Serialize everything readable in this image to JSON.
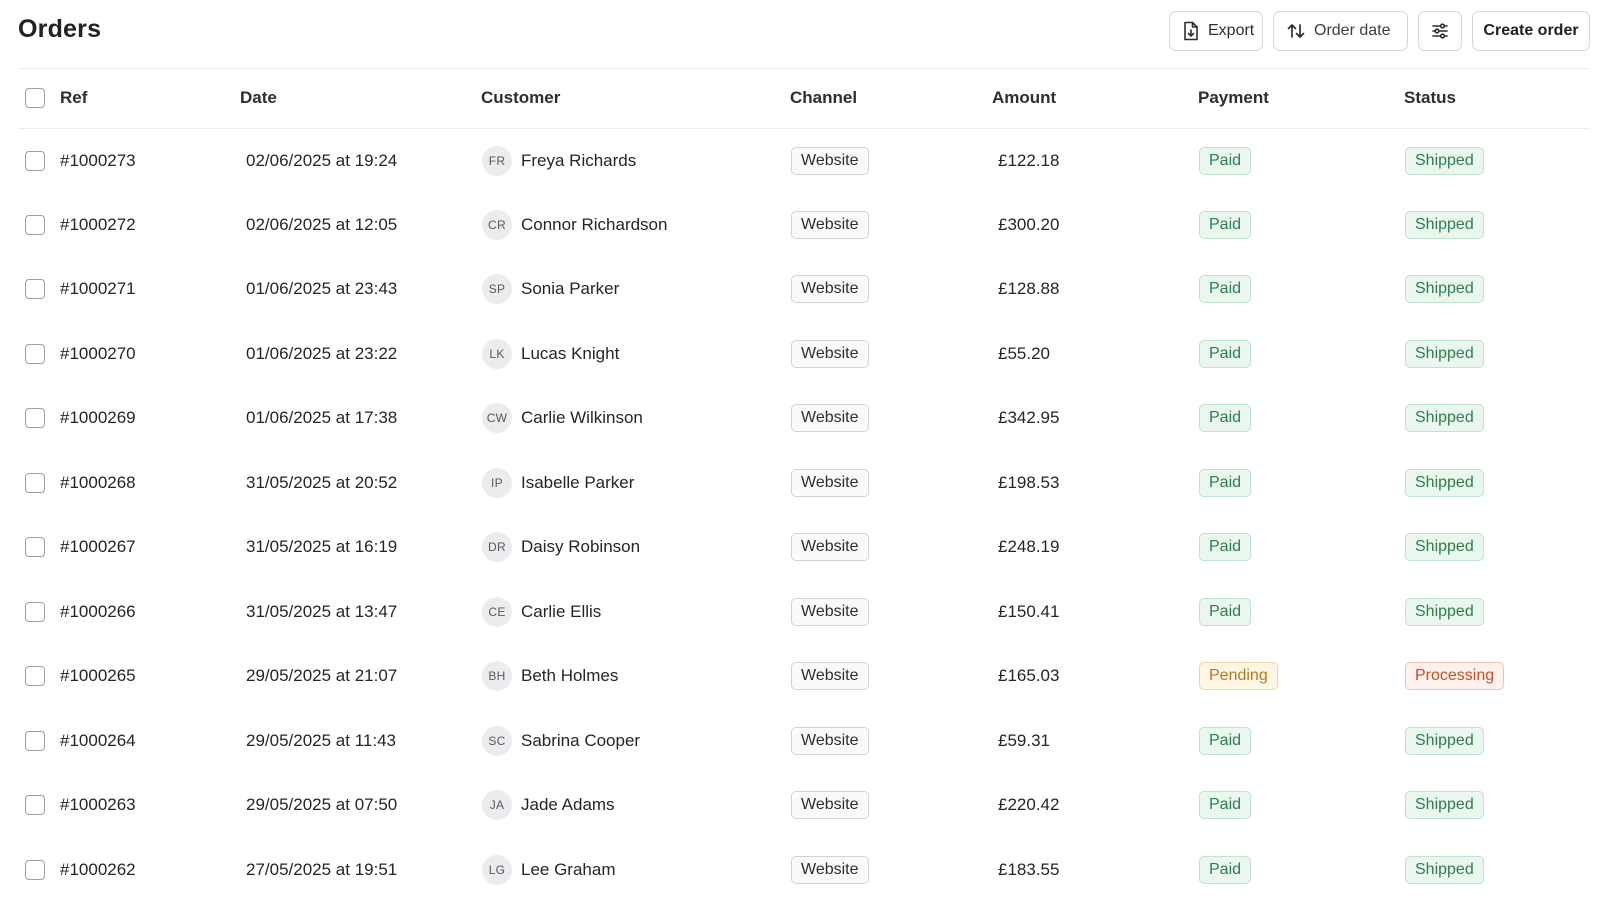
{
  "page": {
    "title": "Orders"
  },
  "toolbar": {
    "export_label": "Export",
    "sort_label": "Order date",
    "create_label": "Create order"
  },
  "columns": {
    "ref": "Ref",
    "date": "Date",
    "customer": "Customer",
    "channel": "Channel",
    "amount": "Amount",
    "payment": "Payment",
    "status": "Status"
  },
  "colors": {
    "paid_bg": "#e9f7ee",
    "paid_text": "#2f7d4e",
    "pending_bg": "#fff6e6",
    "pending_text": "#b7791f",
    "processing_bg": "#fff1ec",
    "processing_text": "#c2502a"
  },
  "orders": [
    {
      "ref": "#1000273",
      "date": "02/06/2025 at 19:24",
      "initials": "FR",
      "customer": "Freya Richards",
      "channel": "Website",
      "amount": "£122.18",
      "payment": "Paid",
      "status": "Shipped"
    },
    {
      "ref": "#1000272",
      "date": "02/06/2025 at 12:05",
      "initials": "CR",
      "customer": "Connor Richardson",
      "channel": "Website",
      "amount": "£300.20",
      "payment": "Paid",
      "status": "Shipped"
    },
    {
      "ref": "#1000271",
      "date": "01/06/2025 at 23:43",
      "initials": "SP",
      "customer": "Sonia Parker",
      "channel": "Website",
      "amount": "£128.88",
      "payment": "Paid",
      "status": "Shipped"
    },
    {
      "ref": "#1000270",
      "date": "01/06/2025 at 23:22",
      "initials": "LK",
      "customer": "Lucas Knight",
      "channel": "Website",
      "amount": "£55.20",
      "payment": "Paid",
      "status": "Shipped"
    },
    {
      "ref": "#1000269",
      "date": "01/06/2025 at 17:38",
      "initials": "CW",
      "customer": "Carlie Wilkinson",
      "channel": "Website",
      "amount": "£342.95",
      "payment": "Paid",
      "status": "Shipped"
    },
    {
      "ref": "#1000268",
      "date": "31/05/2025 at 20:52",
      "initials": "IP",
      "customer": "Isabelle Parker",
      "channel": "Website",
      "amount": "£198.53",
      "payment": "Paid",
      "status": "Shipped"
    },
    {
      "ref": "#1000267",
      "date": "31/05/2025 at 16:19",
      "initials": "DR",
      "customer": "Daisy Robinson",
      "channel": "Website",
      "amount": "£248.19",
      "payment": "Paid",
      "status": "Shipped"
    },
    {
      "ref": "#1000266",
      "date": "31/05/2025 at 13:47",
      "initials": "CE",
      "customer": "Carlie Ellis",
      "channel": "Website",
      "amount": "£150.41",
      "payment": "Paid",
      "status": "Shipped"
    },
    {
      "ref": "#1000265",
      "date": "29/05/2025 at 21:07",
      "initials": "BH",
      "customer": "Beth Holmes",
      "channel": "Website",
      "amount": "£165.03",
      "payment": "Pending",
      "status": "Processing"
    },
    {
      "ref": "#1000264",
      "date": "29/05/2025 at 11:43",
      "initials": "SC",
      "customer": "Sabrina Cooper",
      "channel": "Website",
      "amount": "£59.31",
      "payment": "Paid",
      "status": "Shipped"
    },
    {
      "ref": "#1000263",
      "date": "29/05/2025 at 07:50",
      "initials": "JA",
      "customer": "Jade Adams",
      "channel": "Website",
      "amount": "£220.42",
      "payment": "Paid",
      "status": "Shipped"
    },
    {
      "ref": "#1000262",
      "date": "27/05/2025 at 19:51",
      "initials": "LG",
      "customer": "Lee Graham",
      "channel": "Website",
      "amount": "£183.55",
      "payment": "Paid",
      "status": "Shipped"
    }
  ]
}
